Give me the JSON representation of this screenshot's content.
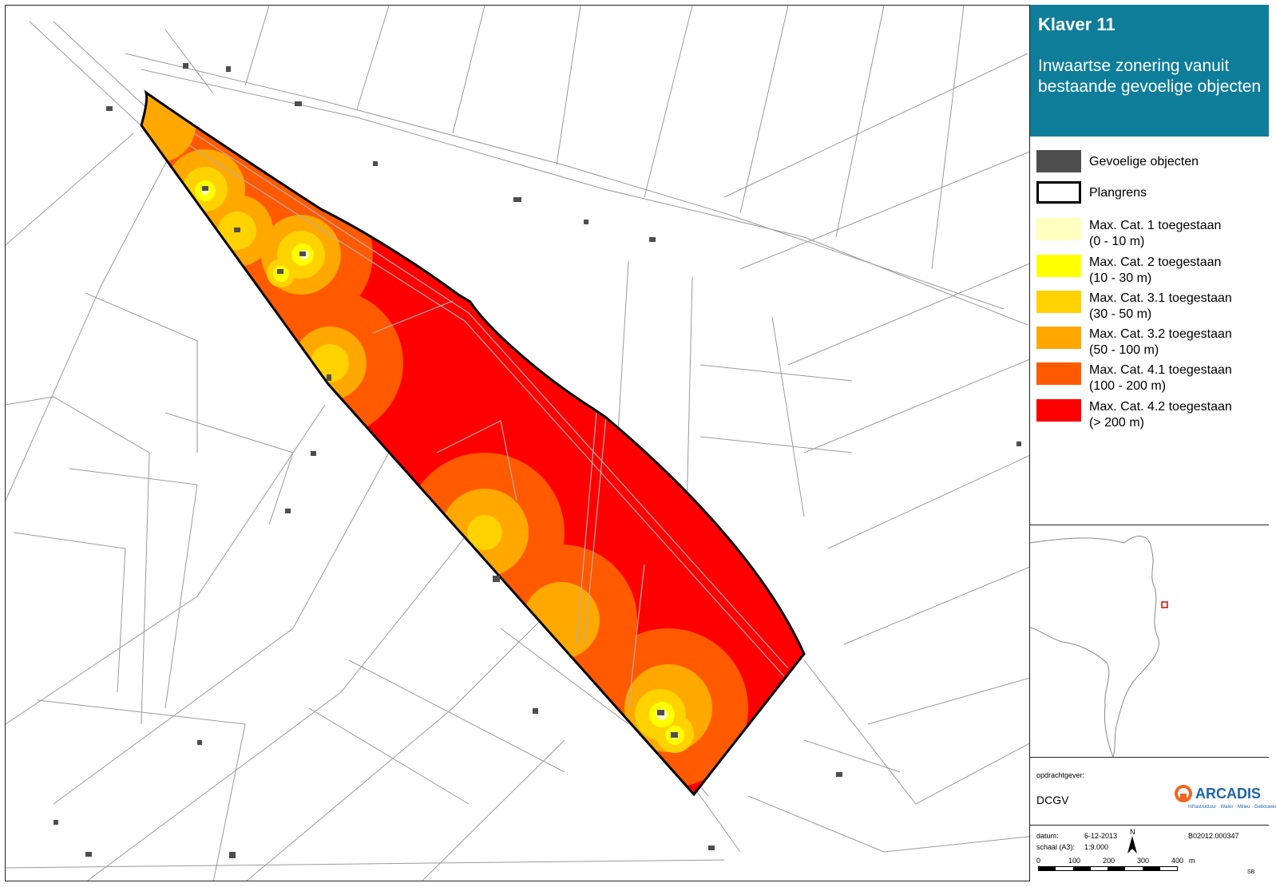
{
  "panel": {
    "title": "Klaver 11",
    "subtitle": "Inwaartse zonering vanuit bestaande gevoelige objecten",
    "title_bg_color": "#0e7d9a"
  },
  "legend": [
    {
      "line1": "Gevoelige objecten",
      "line2": "",
      "color": "#4d4d4d",
      "outline": false
    },
    {
      "line1": "Plangrens",
      "line2": "",
      "color": "#ffffff",
      "outline": true
    },
    {
      "line1": "Max. Cat. 1 toegestaan",
      "line2": "(0 - 10 m)",
      "color": "#ffffc0",
      "outline": false
    },
    {
      "line1": "Max. Cat. 2 toegestaan",
      "line2": "(10 - 30 m)",
      "color": "#ffff00",
      "outline": false
    },
    {
      "line1": "Max. Cat. 3.1 toegestaan",
      "line2": "(30 - 50 m)",
      "color": "#ffd200",
      "outline": false
    },
    {
      "line1": "Max. Cat. 3.2 toegestaan",
      "line2": "(50 - 100 m)",
      "color": "#ffa800",
      "outline": false
    },
    {
      "line1": "Max. Cat. 4.1 toegestaan",
      "line2": "(100 - 200 m)",
      "color": "#ff5a00",
      "outline": false
    },
    {
      "line1": "Max. Cat. 4.2 toegestaan",
      "line2": "(> 200 m)",
      "color": "#ff0000",
      "outline": false
    }
  ],
  "client": {
    "label": "opdrachtgever:",
    "name": "DCGV"
  },
  "logo": {
    "name": "ARCADIS",
    "tagline": "Infrastructuur · Water · Milieu · Gebouwen",
    "color": "#1c64a8",
    "accent": "#f26522"
  },
  "meta": {
    "date_label": "datum:",
    "date_value": "6-12-2013",
    "scale_label": "schaal (A3):",
    "scale_value": "1:9.000",
    "project_number": "B02012.000347",
    "north_label": "N",
    "scalebar_ticks": [
      "0",
      "100",
      "200",
      "300",
      "400"
    ],
    "scalebar_unit": "m",
    "initials": "SB"
  },
  "inset": {
    "location_marker_color": "#e00000"
  }
}
